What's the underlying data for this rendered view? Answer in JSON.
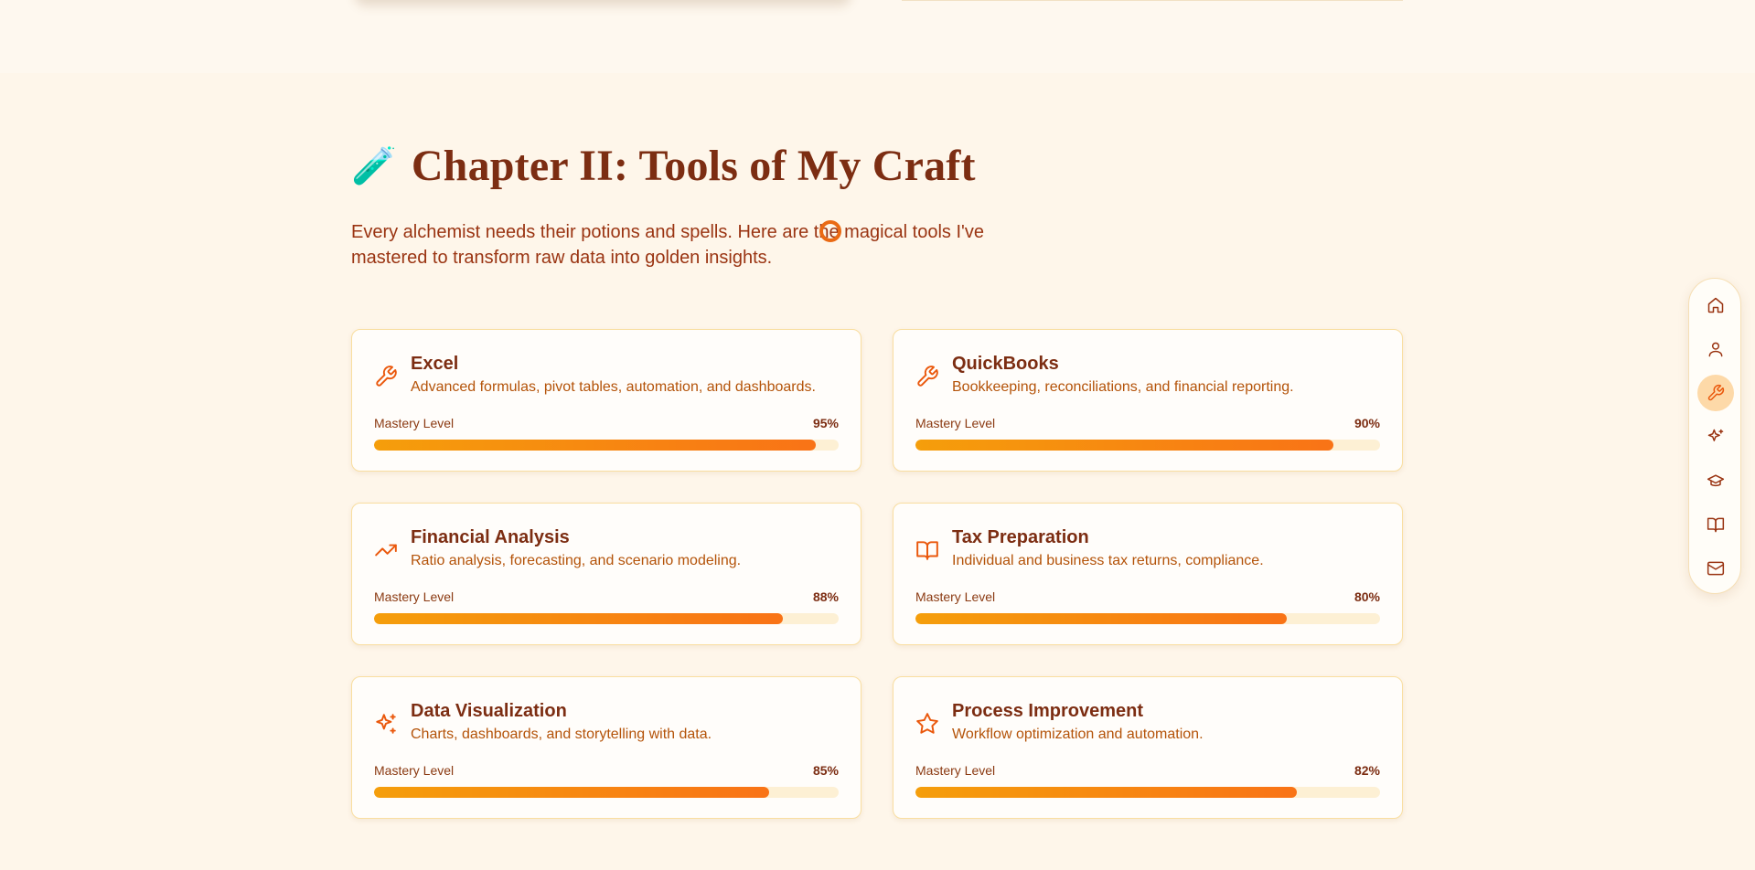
{
  "colors": {
    "background": "#fef6ea",
    "title": "#7c2d12",
    "accent": "#ea580c",
    "bar_start": "#f59e0b",
    "bar_end": "#f97316",
    "bar_track": "#fdf0d4",
    "card_border": "#f9dea0",
    "nav_active": "#fdd9a8"
  },
  "chapter": {
    "icon": "test-tube-icon",
    "icon_glyph": "🧪",
    "title": "Chapter II: Tools of My Craft",
    "intro": "Every alchemist needs their potions and spells. Here are the magical tools I've mastered to transform raw data into golden insights."
  },
  "mastery_label": "Mastery Level",
  "skills": [
    {
      "icon": "wrench-icon",
      "title": "Excel",
      "desc": "Advanced formulas, pivot tables, automation, and dashboards.",
      "percent_label": "95%",
      "percent": 95
    },
    {
      "icon": "wrench-icon",
      "title": "QuickBooks",
      "desc": "Bookkeeping, reconciliations, and financial reporting.",
      "percent_label": "90%",
      "percent": 90
    },
    {
      "icon": "trending-up-icon",
      "title": "Financial Analysis",
      "desc": "Ratio analysis, forecasting, and scenario modeling.",
      "percent_label": "88%",
      "percent": 88
    },
    {
      "icon": "book-open-icon",
      "title": "Tax Preparation",
      "desc": "Individual and business tax returns, compliance.",
      "percent_label": "80%",
      "percent": 80
    },
    {
      "icon": "sparkles-icon",
      "title": "Data Visualization",
      "desc": "Charts, dashboards, and storytelling with data.",
      "percent_label": "85%",
      "percent": 85
    },
    {
      "icon": "star-icon",
      "title": "Process Improvement",
      "desc": "Workflow optimization and automation.",
      "percent_label": "82%",
      "percent": 82
    }
  ],
  "side_nav": [
    {
      "icon": "home-icon",
      "active": false
    },
    {
      "icon": "user-icon",
      "active": false
    },
    {
      "icon": "wrench-icon",
      "active": true
    },
    {
      "icon": "sparkles-icon",
      "active": false
    },
    {
      "icon": "graduation-cap-icon",
      "active": false
    },
    {
      "icon": "book-open-icon",
      "active": false
    },
    {
      "icon": "mail-icon",
      "active": false
    }
  ]
}
